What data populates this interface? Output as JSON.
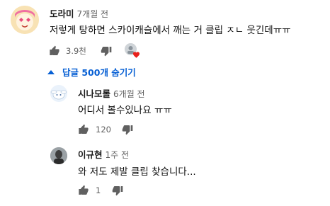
{
  "colors": {
    "link": "#065fd4",
    "muted": "#606060",
    "text": "#111111",
    "heart": "#e8201b"
  },
  "comments": [
    {
      "author": "도라미",
      "time": "7개월 전",
      "text": "저렇게 탕하면 스카이캐슬에서 깨는 거 클립 ㅈㄴ 웃긴데ㅠㅠ",
      "likes": "3.9천",
      "creator_heart": true,
      "avatar_icon": "cartoon-face-avatar"
    }
  ],
  "replies_toggle": {
    "label": "답글 500개 숨기기",
    "icon": "chevron-up-icon"
  },
  "replies": [
    {
      "author": "시나모롤",
      "time": "6개월 전",
      "text": "어디서 볼수있나요 ㅠㅠ",
      "likes": "120",
      "avatar_icon": "cinnamoroll-avatar"
    },
    {
      "author": "이규현",
      "time": "1주 전",
      "text": "와 저도 제발 클립 찾습니다...",
      "likes": "1",
      "avatar_icon": "photo-avatar"
    }
  ]
}
